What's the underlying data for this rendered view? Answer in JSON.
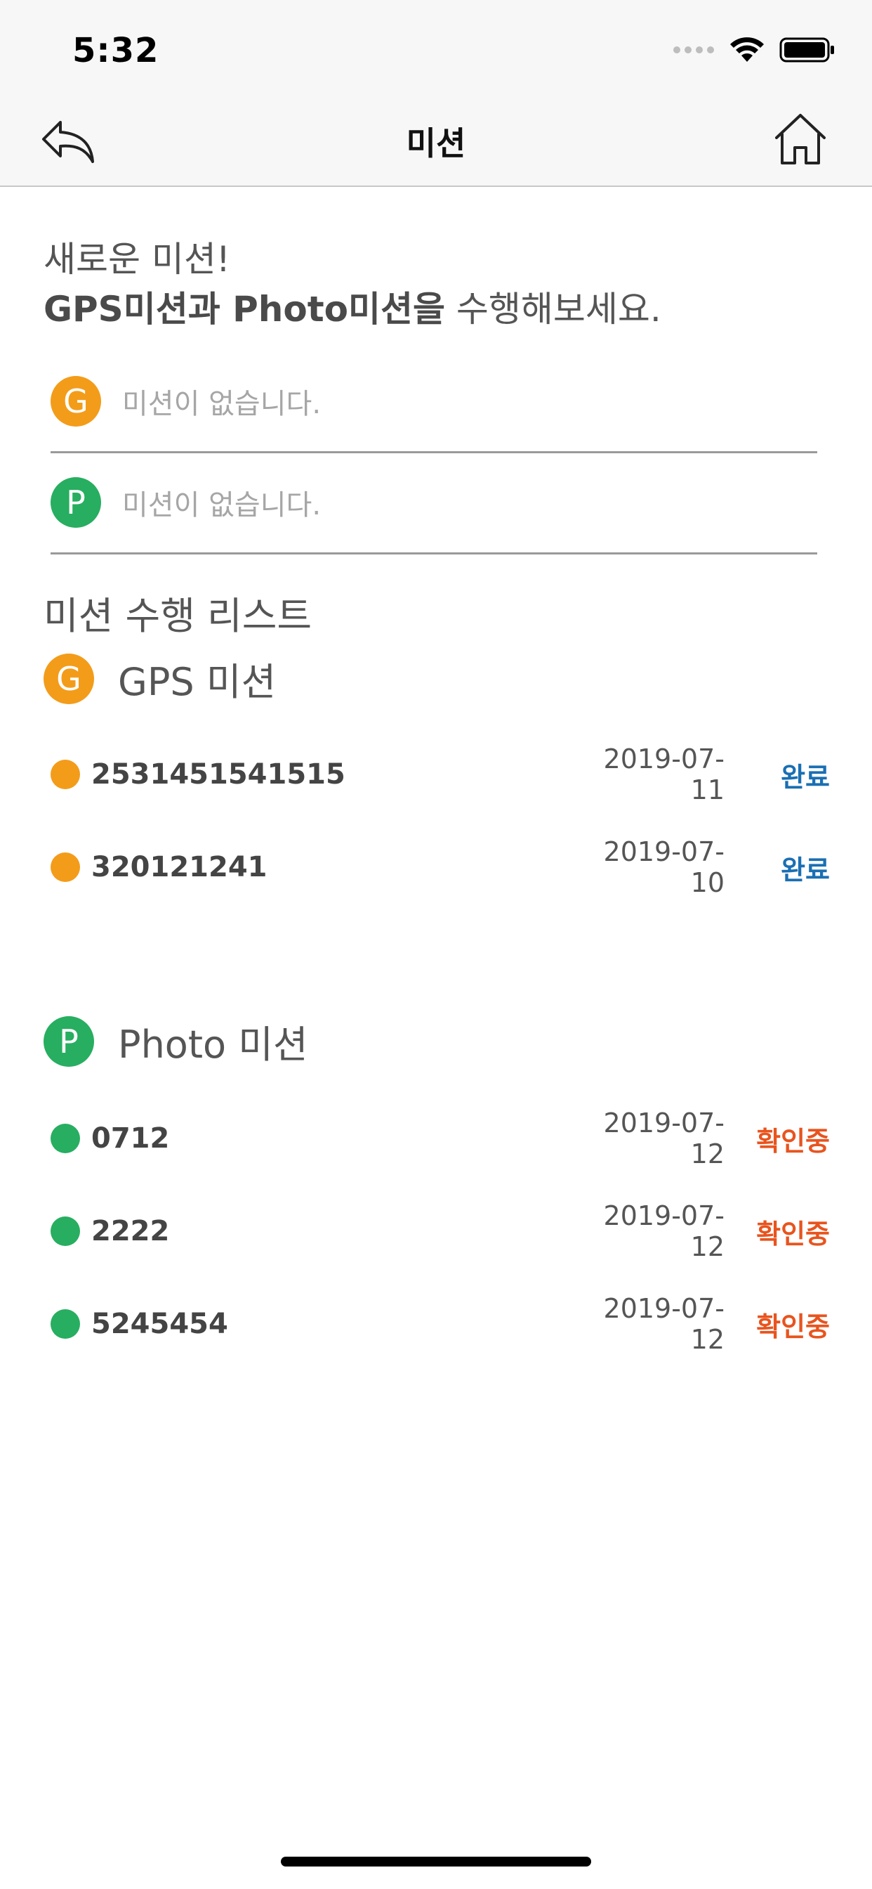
{
  "status_bar": {
    "time": "5:32",
    "signal_icon": "signal-dots-icon",
    "wifi_icon": "wifi-icon",
    "battery_icon": "battery-icon"
  },
  "nav": {
    "title": "미션",
    "back_icon": "back-arrow-icon",
    "home_icon": "home-icon"
  },
  "intro": {
    "line1": "새로운 미션!",
    "line2_bold": "GPS미션과 Photo미션을",
    "line2_rest": " 수행해보세요."
  },
  "current_missions": [
    {
      "badge": "G",
      "text": "미션이 없습니다.",
      "color": "#f39c1a"
    },
    {
      "badge": "P",
      "text": "미션이 없습니다.",
      "color": "#27ae60"
    }
  ],
  "list_title": "미션 수행 리스트",
  "gps": {
    "badge": "G",
    "label": "GPS 미션",
    "items": [
      {
        "name": "2531451541515",
        "date": "2019-07-11",
        "status": "완료"
      },
      {
        "name": "320121241",
        "date": "2019-07-10",
        "status": "완료"
      }
    ]
  },
  "photo": {
    "badge": "P",
    "label": "Photo 미션",
    "items": [
      {
        "name": "0712",
        "date": "2019-07-12",
        "status": "확인중"
      },
      {
        "name": "2222",
        "date": "2019-07-12",
        "status": "확인중"
      },
      {
        "name": "5245454",
        "date": "2019-07-12",
        "status": "확인중"
      }
    ]
  },
  "colors": {
    "gps": "#f39c1a",
    "photo": "#27ae60",
    "status_done": "#1a6fb3",
    "status_pending": "#e8541e"
  }
}
